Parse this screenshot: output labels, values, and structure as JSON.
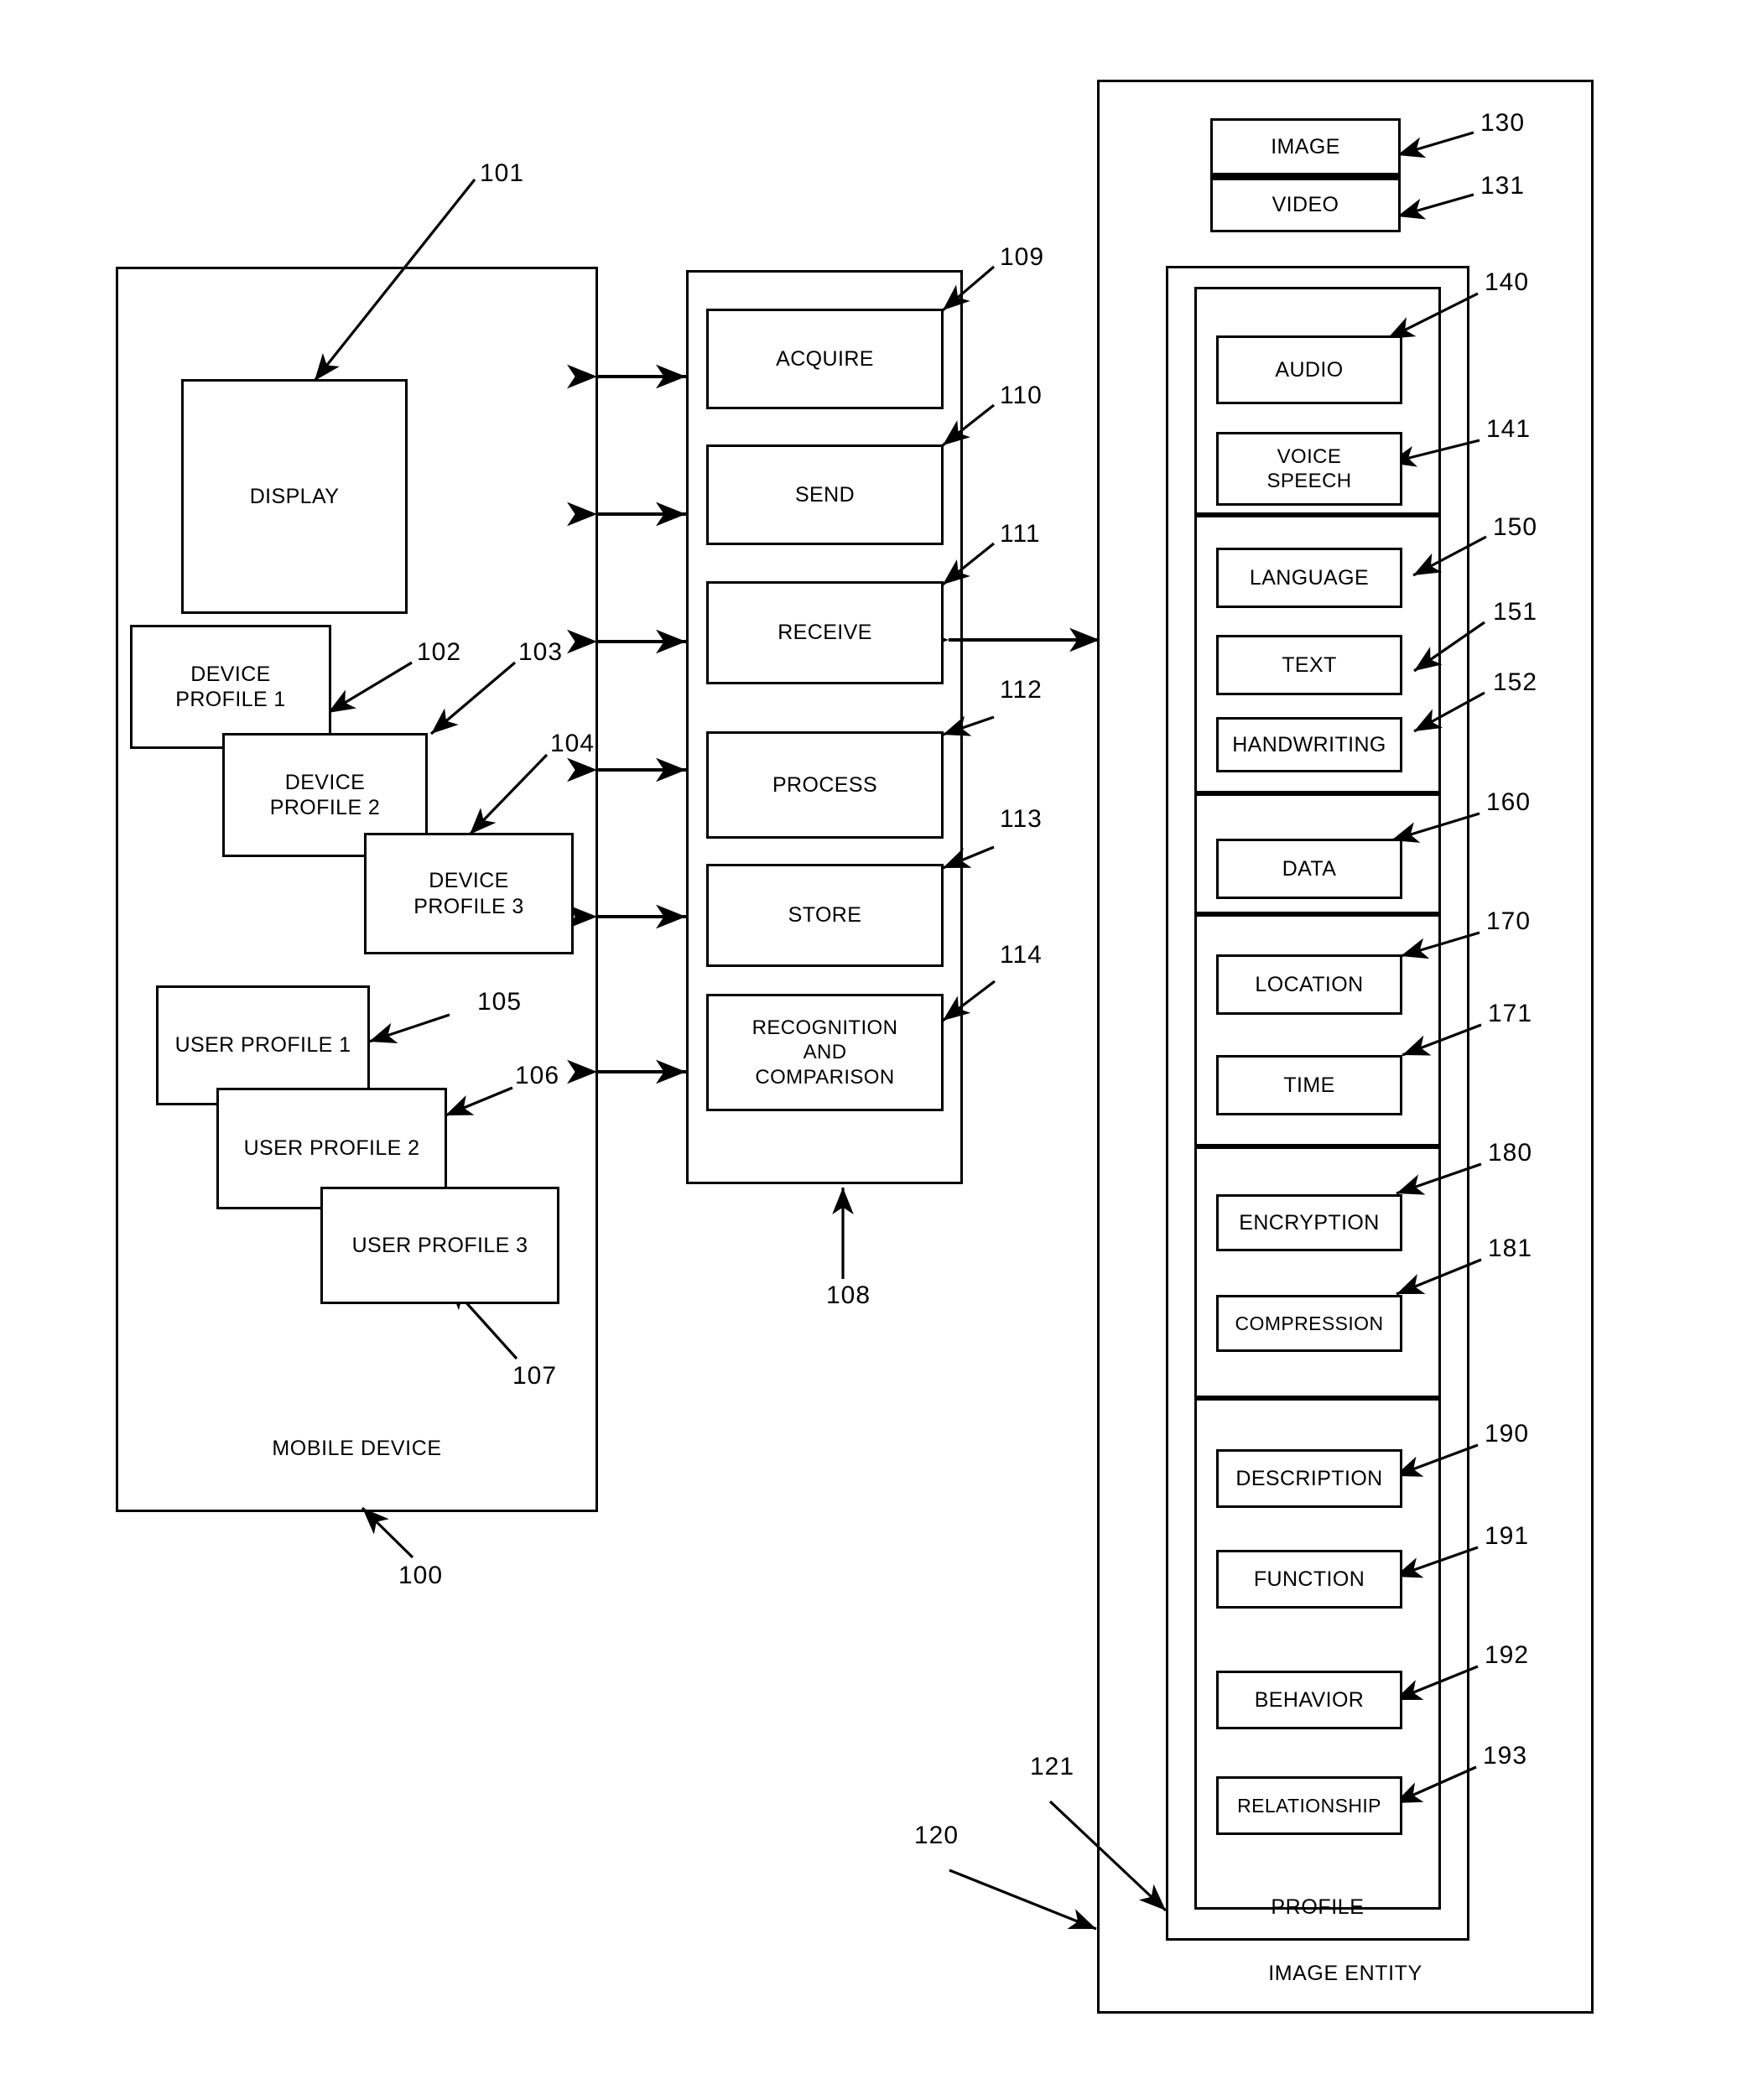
{
  "figure": {
    "mobile_device": {
      "caption": "MOBILE DEVICE",
      "ref": "100",
      "display": {
        "label": "DISPLAY",
        "ref": "101"
      },
      "device_profiles": [
        {
          "label": "DEVICE\nPROFILE 1",
          "ref": "102"
        },
        {
          "label": "DEVICE\nPROFILE 2",
          "ref": "103"
        },
        {
          "label": "DEVICE\nPROFILE 3",
          "ref": "104"
        }
      ],
      "user_profiles": [
        {
          "label": "USER PROFILE 1",
          "ref": "105"
        },
        {
          "label": "USER PROFILE 2",
          "ref": "106"
        },
        {
          "label": "USER PROFILE 3",
          "ref": "107"
        }
      ]
    },
    "processing_unit": {
      "ref": "108",
      "operations": [
        {
          "label": "ACQUIRE",
          "ref": "109"
        },
        {
          "label": "SEND",
          "ref": "110"
        },
        {
          "label": "RECEIVE",
          "ref": "111"
        },
        {
          "label": "PROCESS",
          "ref": "112"
        },
        {
          "label": "STORE",
          "ref": "113"
        },
        {
          "label": "RECOGNITION\nAND\nCOMPARISON",
          "ref": "114"
        }
      ]
    },
    "image_entity": {
      "caption": "IMAGE ENTITY",
      "ref": "120",
      "media": [
        {
          "label": "IMAGE",
          "ref": "130"
        },
        {
          "label": "VIDEO",
          "ref": "131"
        }
      ],
      "profile": {
        "caption": "PROFILE",
        "ref": "121",
        "groups": [
          {
            "items": [
              {
                "label": "AUDIO",
                "ref": "140"
              },
              {
                "label": "VOICE\nSPEECH",
                "ref": "141"
              }
            ]
          },
          {
            "items": [
              {
                "label": "LANGUAGE",
                "ref": "150"
              },
              {
                "label": "TEXT",
                "ref": "151"
              },
              {
                "label": "HANDWRITING",
                "ref": "152"
              }
            ]
          },
          {
            "items": [
              {
                "label": "DATA",
                "ref": "160"
              }
            ]
          },
          {
            "items": [
              {
                "label": "LOCATION",
                "ref": "170"
              },
              {
                "label": "TIME",
                "ref": "171"
              }
            ]
          },
          {
            "items": [
              {
                "label": "ENCRYPTION",
                "ref": "180"
              },
              {
                "label": "COMPRESSION",
                "ref": "181"
              }
            ]
          },
          {
            "items": [
              {
                "label": "DESCRIPTION",
                "ref": "190"
              },
              {
                "label": "FUNCTION",
                "ref": "191"
              },
              {
                "label": "BEHAVIOR",
                "ref": "192"
              },
              {
                "label": "RELATIONSHIP",
                "ref": "193"
              }
            ]
          }
        ]
      }
    }
  }
}
